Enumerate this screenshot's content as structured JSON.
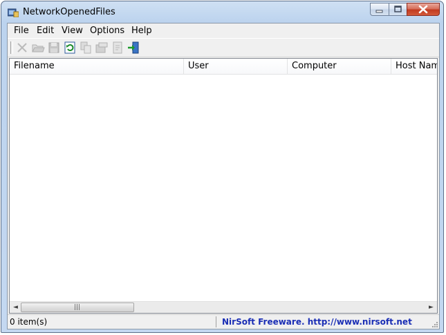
{
  "window": {
    "title": "NetworkOpenedFiles"
  },
  "menu": {
    "items": [
      "File",
      "Edit",
      "View",
      "Options",
      "Help"
    ]
  },
  "toolbar": {
    "buttons": [
      {
        "icon": "delete-icon",
        "enabled": false
      },
      {
        "icon": "open-folder-icon",
        "enabled": false
      },
      {
        "icon": "save-icon",
        "enabled": false
      },
      {
        "icon": "refresh-icon",
        "enabled": true
      },
      {
        "icon": "copy-icon",
        "enabled": false
      },
      {
        "icon": "html-report-icon",
        "enabled": false
      },
      {
        "icon": "properties-icon",
        "enabled": false
      },
      {
        "icon": "exit-icon",
        "enabled": true
      }
    ]
  },
  "list": {
    "columns": [
      "Filename",
      "User",
      "Computer",
      "Host Name"
    ],
    "rows": []
  },
  "status": {
    "items_count": "0 item(s)",
    "credit": "NirSoft Freeware.  http://www.nirsoft.net"
  },
  "colors": {
    "credit_link": "#1a2eb5",
    "close_button": "#c23a1f"
  }
}
